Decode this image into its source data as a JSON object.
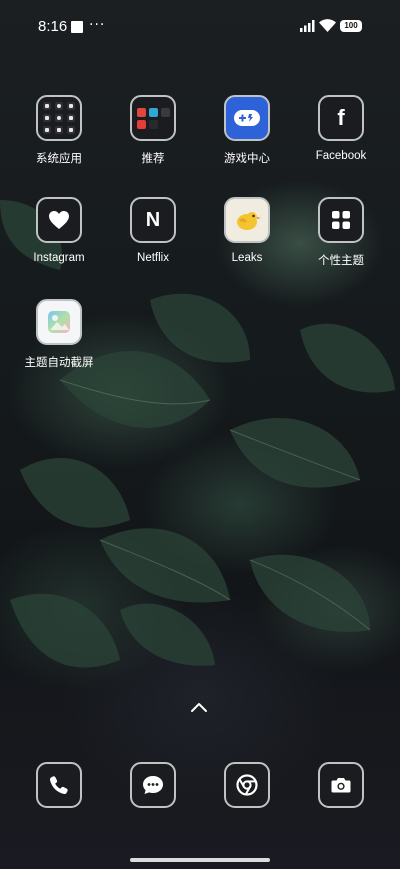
{
  "status_bar": {
    "time": "8:16",
    "more_indicator": "···",
    "battery": "100"
  },
  "apps": [
    {
      "label": "系统应用",
      "icon": "folder-system-apps-icon"
    },
    {
      "label": "推荐",
      "icon": "folder-recommended-icon"
    },
    {
      "label": "游戏中心",
      "icon": "game-controller-icon"
    },
    {
      "label": "Facebook",
      "icon": "facebook-icon"
    },
    {
      "label": "Instagram",
      "icon": "heart-icon"
    },
    {
      "label": "Netflix",
      "icon": "netflix-n-icon"
    },
    {
      "label": "Leaks",
      "icon": "bird-icon"
    },
    {
      "label": "个性主题",
      "icon": "four-squares-icon"
    },
    {
      "label": "主题自动截屏",
      "icon": "photo-icon"
    }
  ],
  "icon_glyphs": {
    "facebook": "f",
    "netflix": "N"
  },
  "dock": [
    {
      "name": "phone",
      "icon": "phone-icon"
    },
    {
      "name": "messages",
      "icon": "message-bubble-icon"
    },
    {
      "name": "browser",
      "icon": "chrome-icon"
    },
    {
      "name": "camera",
      "icon": "camera-icon"
    }
  ],
  "colors": {
    "icon_border": "#bfc3c4",
    "icon_bg": "#1b1c1f",
    "game_blue": "#3a7ff0",
    "bird_yellow": "#f4c430"
  }
}
